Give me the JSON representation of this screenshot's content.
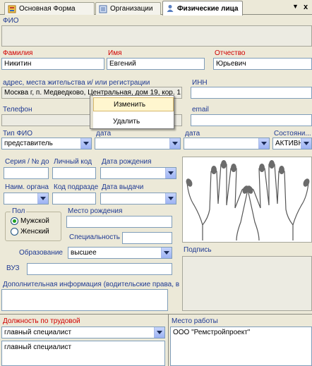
{
  "tabs": [
    {
      "label": "Основная Форма",
      "icon": "form-icon"
    },
    {
      "label": "Организации",
      "icon": "organizations-icon"
    },
    {
      "label": "Физические лица",
      "icon": "person-icon"
    }
  ],
  "tab_controls": {
    "dropdown": "▼",
    "close": "x"
  },
  "fio_label": "ФИО",
  "surname": {
    "label": "Фамилия",
    "value": "Никитин"
  },
  "name": {
    "label": "Имя",
    "value": "Евгений"
  },
  "patronymic": {
    "label": "Отчество",
    "value": "Юрьевич"
  },
  "address": {
    "label": "адрес, места жительства и/ или регистрации",
    "value": "Москва г, п. Медведково, Центральная, дом 19, кор. 1,"
  },
  "inn": {
    "label": "ИНН",
    "value": ""
  },
  "phone": {
    "label": "Телефон",
    "value": ""
  },
  "email": {
    "label": "email",
    "value": ""
  },
  "context_menu": {
    "edit": "Изменить",
    "delete": "Удалить"
  },
  "fio_type": {
    "label": "Тип ФИО",
    "value": "представитель"
  },
  "date1": {
    "label": "дата",
    "value": ""
  },
  "date2": {
    "label": "дата",
    "value": ""
  },
  "status": {
    "label": "Состояни...",
    "value": "АКТИВН"
  },
  "passport_series": {
    "label": "Серия / № до",
    "value": ""
  },
  "personal_code": {
    "label": "Личный код",
    "value": ""
  },
  "birth_date": {
    "label": "Дата рождения",
    "value": ""
  },
  "issuer": {
    "label": "Наим. органа",
    "value": ""
  },
  "division_code": {
    "label": "Код подразде",
    "value": ""
  },
  "issue_date": {
    "label": "Дата выдачи",
    "value": ""
  },
  "gender": {
    "label": "Пол",
    "male": "Мужской",
    "female": "Женский",
    "selected": "male"
  },
  "birth_place": {
    "label": "Место рождения",
    "value": ""
  },
  "specialty": {
    "label": "Специальность",
    "value": ""
  },
  "education": {
    "label": "Образование",
    "value": "высшее"
  },
  "university": {
    "label": "ВУЗ",
    "value": ""
  },
  "additional_info": {
    "label": "Дополнительная информация (водительские права, в",
    "value": ""
  },
  "signature": {
    "label": "Подпись"
  },
  "position": {
    "label": "Должность по трудовой",
    "value": "главный специалист",
    "list": [
      "главный специалист"
    ]
  },
  "workplace": {
    "label": "Место работы",
    "list": [
      "ООО \"Ремстройпроект\""
    ]
  },
  "colors": {
    "required_label": "#d00000",
    "normal_label": "#1f3a93",
    "combo_button": "#9db3f3"
  }
}
